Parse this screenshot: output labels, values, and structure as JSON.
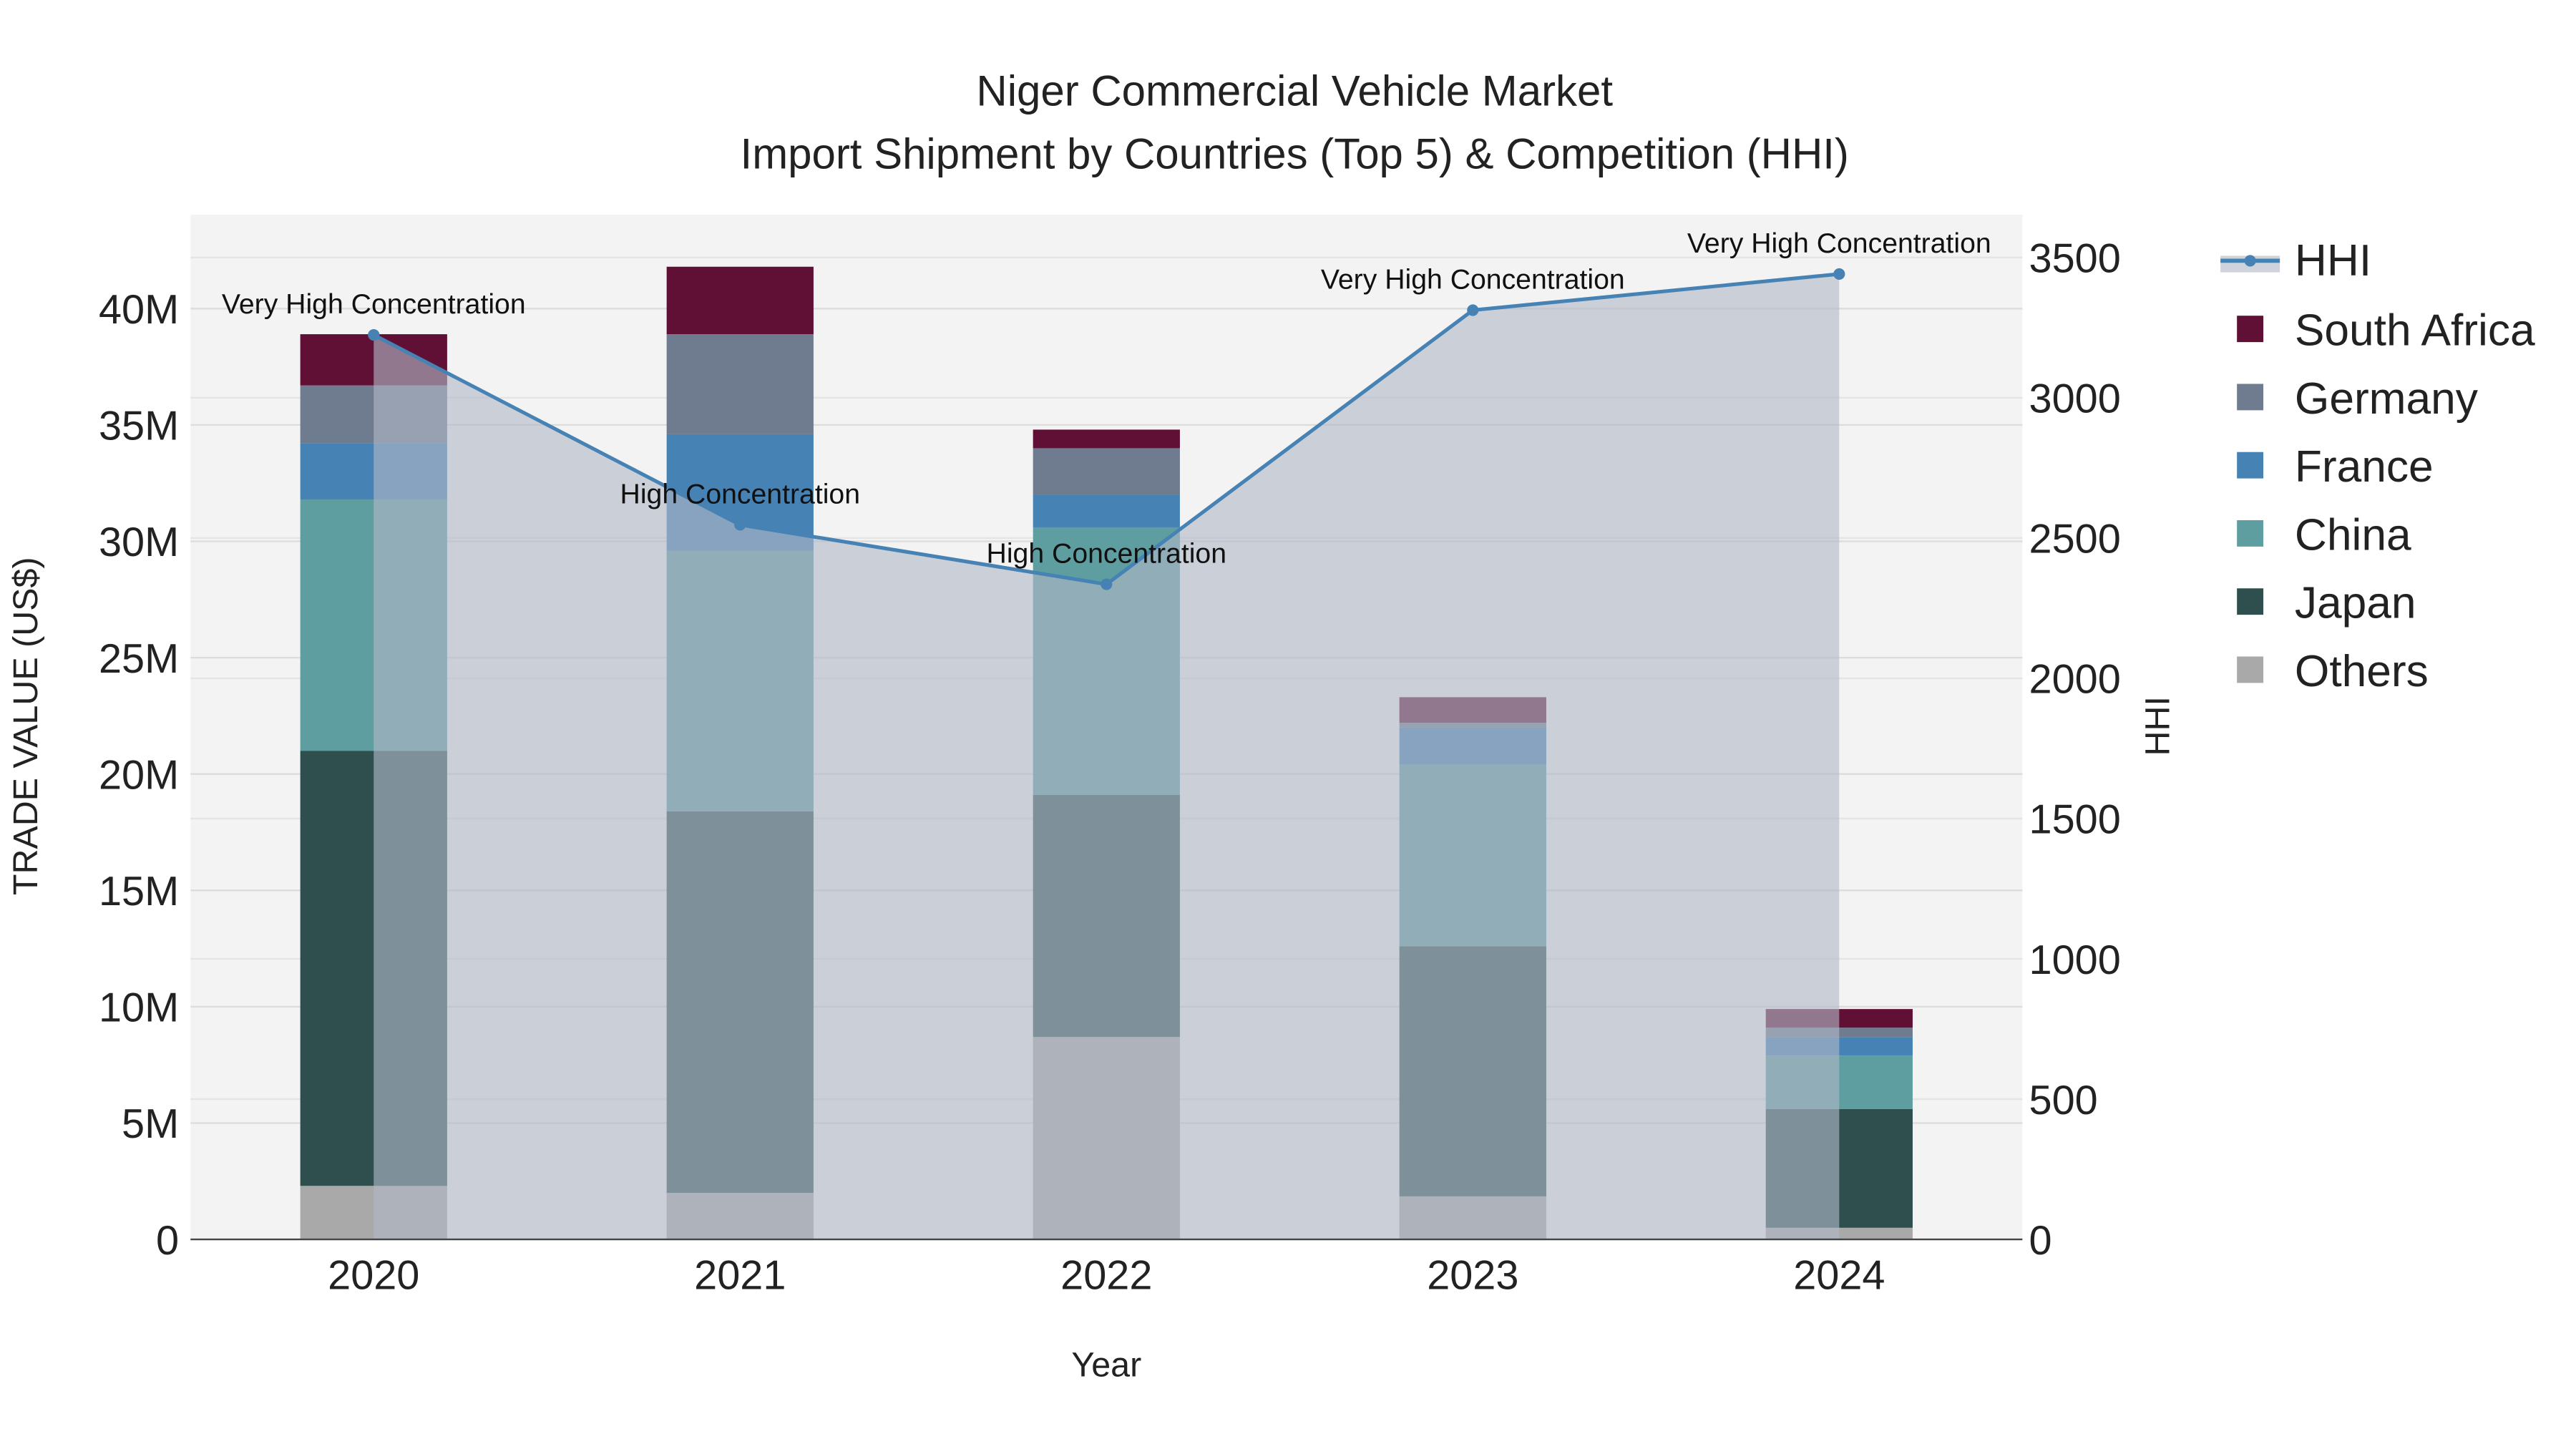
{
  "chart_data": {
    "type": "bar",
    "title": "Niger Commercial Vehicle Market",
    "subtitle": "Import Shipment by Countries (Top 5) & Competition (HHI)",
    "xlabel": "Year",
    "ylabel": "TRADE VALUE (US$)",
    "y2label": "HHI",
    "categories": [
      "2020",
      "2021",
      "2022",
      "2023",
      "2024"
    ],
    "ylim": [
      0,
      44000000
    ],
    "y2lim": [
      0,
      3650
    ],
    "yticks": [
      0,
      5000000,
      10000000,
      15000000,
      20000000,
      25000000,
      30000000,
      35000000,
      40000000
    ],
    "ytick_labels": [
      "0",
      "5M",
      "10M",
      "15M",
      "20M",
      "25M",
      "30M",
      "35M",
      "40M"
    ],
    "y2ticks": [
      0,
      500,
      1000,
      1500,
      2000,
      2500,
      3000,
      3500
    ],
    "y2tick_labels": [
      "0",
      "500",
      "1000",
      "1500",
      "2000",
      "2500",
      "3000",
      "3500"
    ],
    "grid": true,
    "stacked": true,
    "legend_position": "right",
    "series": [
      {
        "name": "Others",
        "color": "#a9a9a9",
        "values": [
          2300000,
          2000000,
          8700000,
          1850000,
          500000
        ]
      },
      {
        "name": "Japan",
        "color": "#2f4f4f",
        "values": [
          18700000,
          16400000,
          10400000,
          10750000,
          5100000
        ]
      },
      {
        "name": "China",
        "color": "#5f9ea0",
        "values": [
          10800000,
          11200000,
          11500000,
          7800000,
          2300000
        ]
      },
      {
        "name": "France",
        "color": "#4682b4",
        "values": [
          2400000,
          5000000,
          1400000,
          1600000,
          800000
        ]
      },
      {
        "name": "Germany",
        "color": "#6f7c8f",
        "values": [
          2500000,
          4300000,
          2000000,
          200000,
          400000
        ]
      },
      {
        "name": "South Africa",
        "color": "#5f1034",
        "values": [
          2200000,
          2900000,
          800000,
          1100000,
          800000
        ]
      }
    ],
    "legend_order": [
      "HHI",
      "South Africa",
      "Germany",
      "France",
      "China",
      "Japan",
      "Others"
    ],
    "line": {
      "name": "HHI",
      "color": "#4682b4",
      "values": [
        3224,
        2547,
        2335,
        3312,
        3441
      ],
      "annotations": [
        "Very High Concentration",
        "High Concentration",
        "High Concentration",
        "Very High Concentration",
        "Very High Concentration"
      ]
    }
  }
}
